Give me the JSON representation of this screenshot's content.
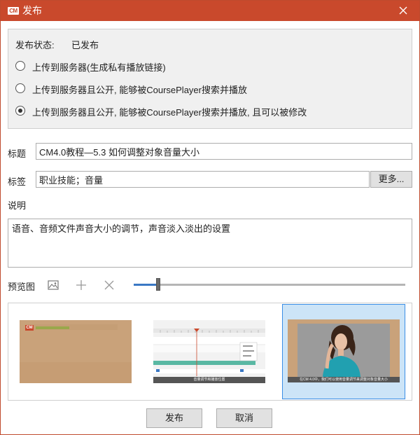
{
  "titlebar": {
    "logo_text": "CM",
    "title": "发布"
  },
  "status": {
    "label": "发布状态:",
    "value": "已发布",
    "options": [
      {
        "label": "上传到服务器(生成私有播放链接)",
        "checked": false
      },
      {
        "label": "上传到服务器且公开, 能够被CoursePlayer搜索并播放",
        "checked": false
      },
      {
        "label": "上传到服务器且公开, 能够被CoursePlayer搜索并播放, 且可以被修改",
        "checked": true
      }
    ]
  },
  "form": {
    "title_label": "标题",
    "title_value": "CM4.0教程—5.3 如何调整对象音量大小",
    "tags_label": "标签",
    "tags_value": "职业技能；音量",
    "more_label": "更多...",
    "desc_label": "说明",
    "desc_value": "语音、音频文件声音大小的调节，声音淡入淡出的设置"
  },
  "preview": {
    "label": "预览图",
    "icons": [
      "image-icon",
      "add-icon",
      "delete-icon"
    ],
    "zoom_level": 0.09,
    "thumbnails": [
      {
        "name": "thumbnail-cover",
        "logo_text": "CM",
        "selected": false
      },
      {
        "name": "thumbnail-timeline",
        "caption": "音量调节和播放位置",
        "selected": false
      },
      {
        "name": "thumbnail-person",
        "caption": "在CM 4.0中，我们可以使用音量调节来调整对象音量大小",
        "selected": true
      }
    ]
  },
  "buttons": {
    "publish": "发布",
    "cancel": "取消"
  },
  "colors": {
    "titlebar": "#c9492c",
    "accent": "#3a78c4",
    "selected_bg": "#cce4f7",
    "cover_tan": "#c9a27a"
  }
}
